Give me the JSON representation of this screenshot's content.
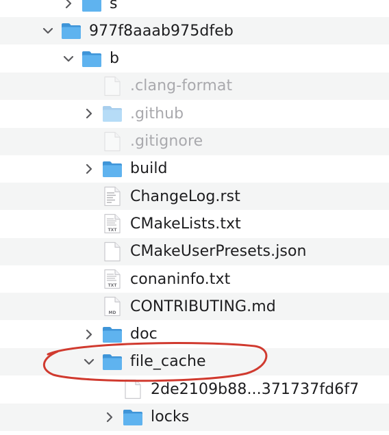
{
  "tree": {
    "rows": [
      {
        "label": "s",
        "icon": "folder-icon",
        "expanded": false,
        "has_chevron": true,
        "dim": false,
        "highlighted": false
      },
      {
        "label": "977f8aaab975dfeb",
        "icon": "folder-icon",
        "expanded": true,
        "has_chevron": true,
        "dim": false,
        "highlighted": false
      },
      {
        "label": "b",
        "icon": "folder-icon",
        "expanded": true,
        "has_chevron": true,
        "dim": false,
        "highlighted": false
      },
      {
        "label": ".clang-format",
        "icon": "file-icon",
        "expanded": false,
        "has_chevron": false,
        "dim": true,
        "highlighted": false
      },
      {
        "label": ".github",
        "icon": "folder-icon",
        "expanded": false,
        "has_chevron": true,
        "dim": true,
        "highlighted": false
      },
      {
        "label": ".gitignore",
        "icon": "file-icon",
        "expanded": false,
        "has_chevron": false,
        "dim": true,
        "highlighted": false
      },
      {
        "label": "build",
        "icon": "folder-icon",
        "expanded": false,
        "has_chevron": true,
        "dim": false,
        "highlighted": false
      },
      {
        "label": "ChangeLog.rst",
        "icon": "text-document-icon",
        "expanded": false,
        "has_chevron": false,
        "dim": false,
        "highlighted": false
      },
      {
        "label": "CMakeLists.txt",
        "icon": "txt-file-icon",
        "badge": "TXT",
        "expanded": false,
        "has_chevron": false,
        "dim": false,
        "highlighted": false
      },
      {
        "label": "CMakeUserPresets.json",
        "icon": "file-icon",
        "expanded": false,
        "has_chevron": false,
        "dim": false,
        "highlighted": false
      },
      {
        "label": "conaninfo.txt",
        "icon": "txt-file-icon",
        "badge": "TXT",
        "expanded": false,
        "has_chevron": false,
        "dim": false,
        "highlighted": false
      },
      {
        "label": "CONTRIBUTING.md",
        "icon": "md-file-icon",
        "badge": "MD",
        "expanded": false,
        "has_chevron": false,
        "dim": false,
        "highlighted": false
      },
      {
        "label": "doc",
        "icon": "folder-icon",
        "expanded": false,
        "has_chevron": true,
        "dim": false,
        "highlighted": false
      },
      {
        "label": "file_cache",
        "icon": "folder-icon",
        "expanded": true,
        "has_chevron": true,
        "dim": false,
        "highlighted": true
      },
      {
        "label": "2de2109b88...371737fd6f7",
        "icon": "file-icon",
        "expanded": false,
        "has_chevron": false,
        "dim": false,
        "highlighted": false
      },
      {
        "label": "locks",
        "icon": "folder-icon",
        "expanded": false,
        "has_chevron": true,
        "dim": false,
        "highlighted": false
      }
    ]
  },
  "colors": {
    "folder_front": "#5fb3ef",
    "folder_back": "#3f95d8",
    "chevron": "#5a5a5e",
    "annotation": "#d03a2f",
    "row_alt": "#f4f5f5"
  }
}
